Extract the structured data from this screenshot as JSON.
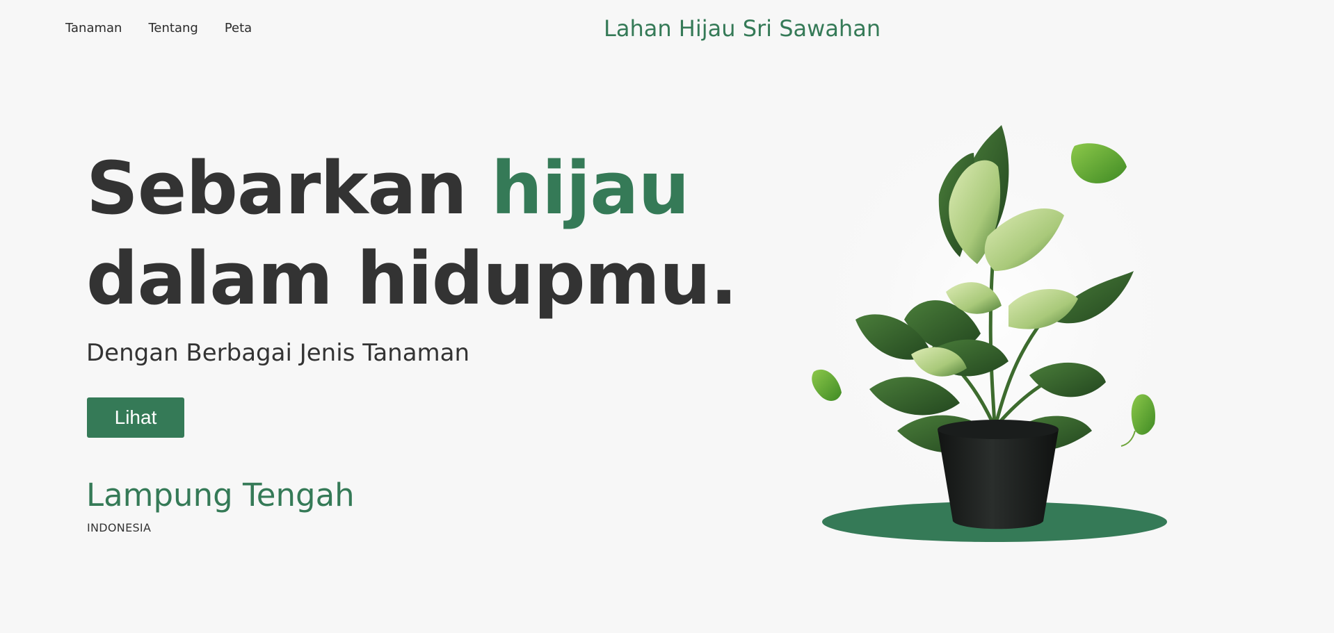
{
  "nav": {
    "items": [
      "Tanaman",
      "Tentang",
      "Peta"
    ]
  },
  "brand": {
    "title": "Lahan Hijau Sri Sawahan"
  },
  "hero": {
    "title_part1": "Sebarkan ",
    "title_accent": "hijau",
    "title_part2": "dalam hidupmu.",
    "subtitle": "Dengan Berbagai Jenis Tanaman",
    "button_label": "Lihat",
    "location": "Lampung Tengah",
    "country": "INDONESIA"
  },
  "illustration": {
    "name": "potted-plant-with-floating-leaves",
    "icon": "plant-icon"
  },
  "colors": {
    "accent": "#357a57",
    "text": "#333333",
    "background": "#f7f7f7",
    "pot": "#1c1f1e",
    "leaf_dark": "#2f5e2a",
    "leaf_light": "#cfe3a8"
  }
}
